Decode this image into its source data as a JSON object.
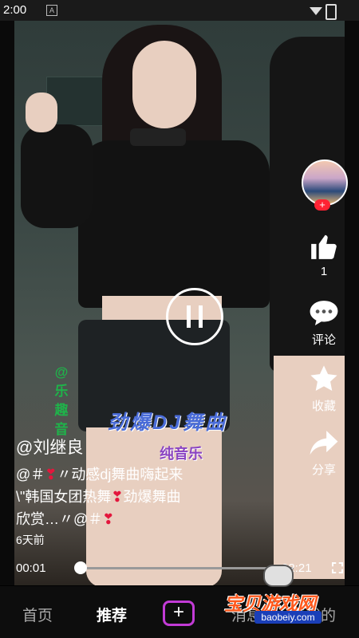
{
  "status_bar": {
    "time": "2:00",
    "notification_icon": "A"
  },
  "video": {
    "overlay_side_text": "@乐趣音",
    "overlay_title": "劲爆DJ舞曲",
    "overlay_subtitle": "纯音乐"
  },
  "actions": {
    "like_count": "1",
    "comment_label": "评论",
    "collect_label": "收藏",
    "share_label": "分享",
    "avatar_plus": "+"
  },
  "post": {
    "username": "@刘继良",
    "description_1": "@＃",
    "description_2": "〃动感dj舞曲嗨起来",
    "description_3": "\\\"韩国女团热舞",
    "description_4": "劲爆舞曲",
    "description_5": "欣赏…〃@＃",
    "heart": "❣",
    "time_ago": "6天前"
  },
  "player": {
    "current_time": "00:01",
    "total_time": "02:21",
    "progress": 0.01
  },
  "tabs": {
    "home": "首页",
    "recommend": "推荐",
    "plus": "+",
    "messages": "消息",
    "me": "我的"
  },
  "watermark": {
    "text": "宝贝游戏网",
    "url": "baobeiy.com"
  }
}
